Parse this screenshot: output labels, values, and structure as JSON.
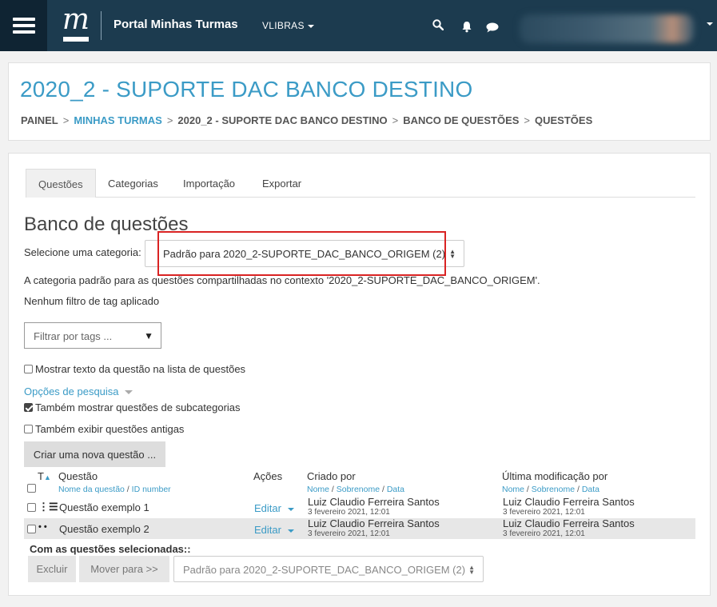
{
  "navbar": {
    "site_name": "Portal Minhas Turmas",
    "logo_letter": "m",
    "language_menu": "VLIBRAS",
    "icons": [
      "menu-icon",
      "search-icon",
      "bell-icon",
      "chat-icon",
      "chevron-down-icon"
    ]
  },
  "header": {
    "title": "2020_2 - SUPORTE DAC BANCO DESTINO",
    "breadcrumb": [
      "PAINEL",
      "MINHAS TURMAS",
      "2020_2 - SUPORTE DAC BANCO DESTINO",
      "BANCO DE QUESTÕES",
      "QUESTÕES"
    ],
    "breadcrumb_separator": ">"
  },
  "tabs": [
    "Questões",
    "Categorias",
    "Importação",
    "Exportar"
  ],
  "bank": {
    "title": "Banco de questões",
    "category_label": "Selecione uma categoria:",
    "category_selected": "Padrão para 2020_2-SUPORTE_DAC_BANCO_ORIGEM (2)",
    "category_info": "A categoria padrão para as questões compartilhadas no contexto '2020_2-SUPORTE_DAC_BANCO_ORIGEM'.",
    "tag_filter_status": "Nenhum filtro de tag aplicado",
    "tag_filter_placeholder": "Filtrar por tags ...",
    "show_text_label": "Mostrar texto da questão na lista de questões",
    "search_options": "Opções de pesquisa",
    "subcategories_label": "Também mostrar questões de subcategorias",
    "old_questions_label": "Também exibir questões antigas",
    "create_button": "Criar uma nova questão ..."
  },
  "table": {
    "col_type": "T",
    "col_question": "Questão",
    "col_question_sub": [
      "Nome da questão",
      "ID number"
    ],
    "col_actions": "Ações",
    "col_created": "Criado por",
    "col_created_sub": [
      "Nome",
      "Sobrenome",
      "Data"
    ],
    "col_modified": "Última modificação por",
    "col_modified_sub": [
      "Nome",
      "Sobrenome",
      "Data"
    ],
    "rows": [
      {
        "name": "Questão exemplo 1",
        "type_icon": "multichoice-icon",
        "action": "Editar",
        "created_by": "Luiz Claudio Ferreira Santos",
        "created_date": "3 fevereiro 2021, 12:01",
        "modified_by": "Luiz Claudio Ferreira Santos",
        "modified_date": "3 fevereiro 2021, 12:01"
      },
      {
        "name": "Questão exemplo 2",
        "type_icon": "dots-icon",
        "action": "Editar",
        "created_by": "Luiz Claudio Ferreira Santos",
        "created_date": "3 fevereiro 2021, 12:01",
        "modified_by": "Luiz Claudio Ferreira Santos",
        "modified_date": "3 fevereiro 2021, 12:01"
      }
    ]
  },
  "bulk": {
    "label": "Com as questões selecionadas::",
    "delete_button": "Excluir",
    "move_button": "Mover para >>",
    "move_target": "Padrão para 2020_2-SUPORTE_DAC_BANCO_ORIGEM (2)"
  },
  "colors": {
    "navbar": "#1c3b4f",
    "accent": "#3b9bc6",
    "highlight_box": "#d92323"
  }
}
